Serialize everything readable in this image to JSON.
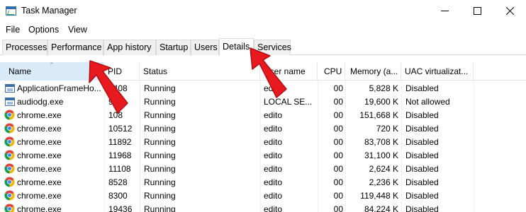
{
  "window": {
    "title": "Task Manager"
  },
  "menu": [
    "File",
    "Options",
    "View"
  ],
  "tabs": [
    "Processes",
    "Performance",
    "App history",
    "Startup",
    "Users",
    "Details",
    "Services"
  ],
  "active_tab": "Details",
  "columns": {
    "name": "Name",
    "pid": "PID",
    "status": "Status",
    "user": "User name",
    "cpu": "CPU",
    "memory": "Memory (a...",
    "uac": "UAC virtualizat..."
  },
  "sorted_column": "name",
  "rows": [
    {
      "icon": "app-window-icon",
      "name": "ApplicationFrameHo...",
      "pid": "7408",
      "status": "Running",
      "user": "edito",
      "cpu": "00",
      "memory": "5,828 K",
      "uac": "Disabled"
    },
    {
      "icon": "app-window-icon",
      "name": "audiodg.exe",
      "pid": "9",
      "status": "Running",
      "user": "LOCAL SE...",
      "cpu": "00",
      "memory": "19,600 K",
      "uac": "Not allowed"
    },
    {
      "icon": "chrome-icon",
      "name": "chrome.exe",
      "pid": "108",
      "status": "Running",
      "user": "edito",
      "cpu": "00",
      "memory": "151,668 K",
      "uac": "Disabled"
    },
    {
      "icon": "chrome-icon",
      "name": "chrome.exe",
      "pid": "10512",
      "status": "Running",
      "user": "edito",
      "cpu": "00",
      "memory": "720 K",
      "uac": "Disabled"
    },
    {
      "icon": "chrome-icon",
      "name": "chrome.exe",
      "pid": "11892",
      "status": "Running",
      "user": "edito",
      "cpu": "00",
      "memory": "83,708 K",
      "uac": "Disabled"
    },
    {
      "icon": "chrome-icon",
      "name": "chrome.exe",
      "pid": "11968",
      "status": "Running",
      "user": "edito",
      "cpu": "00",
      "memory": "31,100 K",
      "uac": "Disabled"
    },
    {
      "icon": "chrome-icon",
      "name": "chrome.exe",
      "pid": "11108",
      "status": "Running",
      "user": "edito",
      "cpu": "00",
      "memory": "2,624 K",
      "uac": "Disabled"
    },
    {
      "icon": "chrome-icon",
      "name": "chrome.exe",
      "pid": "8528",
      "status": "Running",
      "user": "edito",
      "cpu": "00",
      "memory": "2,236 K",
      "uac": "Disabled"
    },
    {
      "icon": "chrome-icon",
      "name": "chrome.exe",
      "pid": "8300",
      "status": "Running",
      "user": "edito",
      "cpu": "00",
      "memory": "119,448 K",
      "uac": "Disabled"
    },
    {
      "icon": "chrome-icon",
      "name": "chrome.exe",
      "pid": "19436",
      "status": "Running",
      "user": "edito",
      "cpu": "00",
      "memory": "84,224 K",
      "uac": "Disabled"
    }
  ],
  "colors": {
    "sorted_header_bg": "#d9ebf9",
    "annotation_arrow": "#e8191f"
  },
  "annotations": [
    "red-arrow-to-name-column",
    "red-arrow-to-details-tab"
  ]
}
